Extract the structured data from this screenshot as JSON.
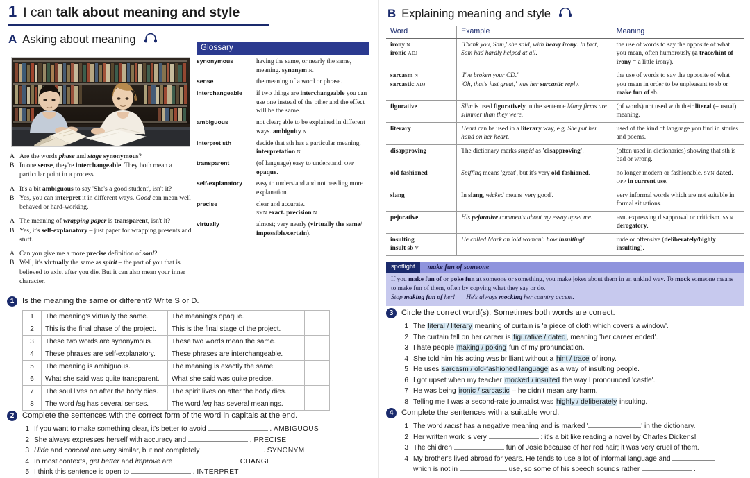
{
  "unit": {
    "number": "1",
    "title_plain": "I can ",
    "title_bold": "talk about meaning and style"
  },
  "section_a": {
    "letter": "A",
    "title": "Asking about meaning",
    "audio_icon": "headphones-icon"
  },
  "glossary": {
    "heading": "Glossary",
    "entries": [
      {
        "term": "synonymous",
        "def_html": "having the same, or nearly the same, meaning. <b>synonym</b> <span class='sc'>N.</span>"
      },
      {
        "term": "sense",
        "def_html": "the meaning of a word or phrase."
      },
      {
        "term": "interchangeable",
        "def_html": "if two things are <b>interchangeable</b> you can use one instead of the other and the effect will be the same."
      },
      {
        "term": "ambiguous",
        "def_html": "not clear; able to be explained in different ways. <b>ambiguity</b> <span class='sc'>N.</span>"
      },
      {
        "term": "interpret sth",
        "def_html": "decide that sth has a particular meaning. <b>interpretation</b> <span class='sc'>N.</span>"
      },
      {
        "term": "transparent",
        "def_html": "(of language) easy to understand. <span class='sc'>OPP</span> <b>opaque</b>."
      },
      {
        "term": "self-explanatory",
        "def_html": "easy to understand and not needing more explanation."
      },
      {
        "term": "precise",
        "def_html": "clear and accurate.<br><span class='sc'>SYN</span> <b>exact. precision</b> <span class='sc'>N.</span>"
      },
      {
        "term": "virtually",
        "def_html": "almost; very nearly (<b>virtually the same/ impossible/certain</b>)."
      }
    ]
  },
  "photo": {
    "alt": "two students studying together in a library"
  },
  "dialogues": [
    {
      "lines": [
        {
          "speaker": "A",
          "html": "Are the words <span class='bi'>phase</span> and <span class='bi'>stage</span> <b>synonymous</b>?"
        },
        {
          "speaker": "B",
          "html": "In one <b>sense</b>, they're <b>interchangeable</b>. They both mean a particular point in a process."
        }
      ]
    },
    {
      "lines": [
        {
          "speaker": "A",
          "html": "It's a bit <b>ambiguous</b> to say 'She's a good student', isn't it?"
        },
        {
          "speaker": "B",
          "html": "Yes, you can <b>interpret</b> it in different ways. <i>Good</i> can mean well behaved or hard-working."
        }
      ]
    },
    {
      "lines": [
        {
          "speaker": "A",
          "html": "The meaning of <span class='bi'>wrapping paper</span> is <b>transparent</b>, isn't it?"
        },
        {
          "speaker": "B",
          "html": "Yes, it's <b>self-explanatory</b> &ndash; just paper for wrapping presents and stuff."
        }
      ]
    },
    {
      "lines": [
        {
          "speaker": "A",
          "html": "Can you give me a more <b>precise</b> definition of <span class='bi'>soul</span>?"
        },
        {
          "speaker": "B",
          "html": "Well, it's <b>virtually</b> the same as <span class='bi'>spirit</span> &ndash; the part of you that is believed to exist after you die. But it can also mean your inner character."
        }
      ]
    }
  ],
  "exercise_1": {
    "number": "1",
    "instruction": "Is the meaning the same or different? Write S or D.",
    "rows": [
      {
        "n": "1",
        "left": "The meaning's virtually the same.",
        "right": "The meaning's opaque.",
        "answer": ""
      },
      {
        "n": "2",
        "left": "This is the final phase of the project.",
        "right": "This is the final stage of the project.",
        "answer": ""
      },
      {
        "n": "3",
        "left": "These two words are synonymous.",
        "right": "These two words mean the same.",
        "answer": ""
      },
      {
        "n": "4",
        "left": "These phrases are self-explanatory.",
        "right": "These phrases are interchangeable.",
        "answer": ""
      },
      {
        "n": "5",
        "left": "The meaning is ambiguous.",
        "right": "The meaning is exactly the same.",
        "answer": ""
      },
      {
        "n": "6",
        "left": "What she said was quite transparent.",
        "right": "What she said was quite precise.",
        "answer": ""
      },
      {
        "n": "7",
        "left": "The soul lives on after the body dies.",
        "right": "The spirit lives on after the body dies.",
        "answer": ""
      },
      {
        "n": "8",
        "left_html": "The word <i>leg</i> has several senses.",
        "right_html": "The word <i>leg</i> has several meanings.",
        "answer": ""
      }
    ]
  },
  "exercise_2": {
    "number": "2",
    "instruction": "Complete the sentences with the correct form of the word in capitals at the end.",
    "items": [
      {
        "n": "1",
        "html": "If you want to make something clear, it's better to avoid <span class='gap' style='width:86px'></span> . <span class='caps'>AMBIGUOUS</span>"
      },
      {
        "n": "2",
        "html": "She always expresses herself with accuracy and <span class='gap' style='width:86px'></span> . <span class='caps'>PRECISE</span>"
      },
      {
        "n": "3",
        "html": "<i>Hide</i> and <i>conceal</i> are very similar, but not completely <span class='gap' style='width:86px'></span> . <span class='caps'>SYNONYM</span>"
      },
      {
        "n": "4",
        "html": "In most contexts, <i>get better</i> and <i>improve</i> are <span class='gap' style='width:86px'></span> . <span class='caps'>CHANGE</span>"
      },
      {
        "n": "5",
        "html": "I think this sentence is open to <span class='gap' style='width:86px'></span> . <span class='caps'>INTERPRET</span>"
      }
    ]
  },
  "section_b": {
    "letter": "B",
    "title": "Explaining meaning and style",
    "audio_icon": "headphones-icon"
  },
  "word_table": {
    "headers": [
      "Word",
      "Example",
      "Meaning"
    ],
    "rows": [
      {
        "word_html": "<b>irony</b> <span class='pos'>N</span><br><b>ironic</b> <span class='pos'>ADJ</span>",
        "example_html": "<i>'Thank you, Sam,' she said, with </i><span class='bi'>heavy irony</span><i>. In fact, Sam had hardly helped at all.</i>",
        "meaning_html": "the use of words to say the opposite of what you mean, often humorously (<b>a trace/hint of irony</b> = a little irony)."
      },
      {
        "word_html": "<b>sarcasm</b> <span class='pos'>N</span><br><b>sarcastic</b> <span class='pos'>ADJ</span>",
        "example_html": "<i>'I've broken your CD.'</i><br><i>'Oh, that's just great,' was her </i><span class='bi'>sarcastic</span><i> reply.</i>",
        "meaning_html": "the use of words to say the opposite of what you mean in order to be unpleasant to sb or <b>make fun of</b> sb."
      },
      {
        "word_html": "<b>figurative</b>",
        "example_html": "<i>Slim</i> is used <b>figuratively</b> in the sentence <i>Many firms are slimmer than they were.</i>",
        "meaning_html": "(of words) not used with their <b>literal</b> (= usual) meaning."
      },
      {
        "word_html": "<b>literary</b>",
        "example_html": "<i>Heart</i> can be used in a <b>literary</b> way, e.g. <i>She put her hand on her heart.</i>",
        "meaning_html": "used of the kind of language you find in stories and poems."
      },
      {
        "word_html": "<b>disapproving</b>",
        "example_html": "The dictionary marks <i>stupid</i> as <b>'disapproving'</b>.",
        "meaning_html": "(often used in dictionaries) showing that sth is bad or wrong."
      },
      {
        "word_html": "<b>old-fashioned</b>",
        "example_html": "<i>Spiffing</i> means 'great', but it's very <b>old-fashioned</b>.",
        "meaning_html": "no longer modern or fashionable. <span class='sc'>SYN</span> <b>dated</b>. <span class='sc'>OPP</span> <b>in current use</b>."
      },
      {
        "word_html": "<b>slang</b>",
        "example_html": "In <b>slang</b>, <i>wicked</i> means 'very good'.",
        "meaning_html": "very informal words which are not suitable in formal situations."
      },
      {
        "word_html": "<b>pejorative</b>",
        "example_html": "<i>His </i><span class='bi'>pejorative</span><i> comments about my essay upset me.</i>",
        "meaning_html": "<span class='sc'>FML</span> expressing disapproval or criticism. <span class='sc'>SYN</span> <b>derogatory</b>."
      },
      {
        "word_html": "<b>insulting</b><br><b>insult sb</b> <span class='pos'>V</span>",
        "example_html": "<i>He called Mark an 'old woman': how </i><span class='bi'>insulting</span><i>!</i>",
        "meaning_html": "rude or offensive (<b>deliberately/highly insulting</b>)."
      }
    ]
  },
  "spotlight": {
    "tag": "spotlight",
    "word": "make fun of someone",
    "body_html": "If you <b>make fun of</b> or <b>poke fun at</b> someone or something, you make jokes about them in an unkind way. To <b>mock</b> someone means to make fun of them, often by copying what they say or do.<br><i>Stop </i><span class='bi'>making fun of</span><i> her!</i><span class='sp-gap'></span><i>He's always </i><span class='bi'>mocking</span><i> her country accent.</i>"
  },
  "exercise_3": {
    "number": "3",
    "instruction": "Circle the correct word(s). Sometimes both words are correct.",
    "items": [
      {
        "n": "1",
        "html": "The <span class='hl'>literal / literary</span> meaning of curtain is 'a piece of cloth which covers a window'."
      },
      {
        "n": "2",
        "html": "The curtain fell on her career is <span class='hl'>figurative / dated</span>, meaning 'her career ended'."
      },
      {
        "n": "3",
        "html": "I hate people <span class='hl'>making / poking</span> fun of my pronunciation."
      },
      {
        "n": "4",
        "html": "She told him his acting was brilliant without a <span class='hl'>hint / trace</span> of irony."
      },
      {
        "n": "5",
        "html": "He uses <span class='hl'>sarcasm / old-fashioned language</span> as a way of insulting people."
      },
      {
        "n": "6",
        "html": "I got upset when my teacher <span class='hl'>mocked / insulted</span> the way I pronounced 'castle'."
      },
      {
        "n": "7",
        "html": "He was being <span class='hl'>ironic / sarcastic</span> &ndash; he didn't mean any harm."
      },
      {
        "n": "8",
        "html": "Telling me I was a second-rate journalist was <span class='hl'>highly / deliberately</span> insulting."
      }
    ]
  },
  "exercise_4": {
    "number": "4",
    "instruction": "Complete the sentences with a suitable word.",
    "items": [
      {
        "n": "1",
        "html": "The word <i>racist</i> has a negative meaning and is marked '<span class='gap' style='width:76px'></span>' in the dictionary."
      },
      {
        "n": "2",
        "html": "Her written work is very <span class='gap' style='width:72px'></span> : it's a bit like reading a novel by Charles Dickens!"
      },
      {
        "n": "3",
        "html": "The children <span class='gap' style='width:72px'></span> fun of Josie because of her red hair; it was very cruel of them."
      },
      {
        "n": "4",
        "html": "My brother's lived abroad for years. He tends to use a lot of informal language and <span class='gap' style='width:62px'></span><br>which is not in <span class='gap' style='width:68px'></span> use, so some of his speech sounds rather <span class='gap' style='width:72px'></span> ."
      }
    ]
  },
  "colors": {
    "accent_navy": "#1a2a6c",
    "glossary_bar": "#2b3a8f",
    "spotlight_band": "#8f94dd",
    "spotlight_body": "#c7c9ee",
    "highlight": "#d8eaf5"
  }
}
